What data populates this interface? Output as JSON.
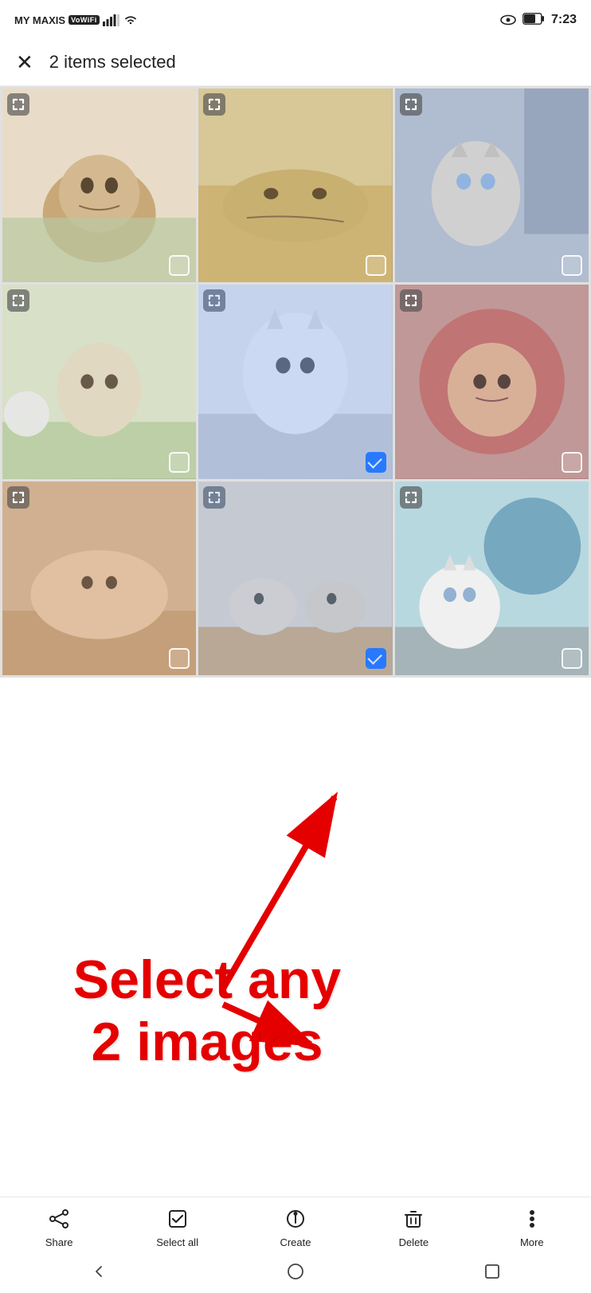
{
  "statusBar": {
    "carrier": "MY MAXIS",
    "vowifi": "VoWiFi",
    "battery": "61",
    "time": "7:23"
  },
  "header": {
    "selectedCount": "2 items selected",
    "closeLabel": "×"
  },
  "photos": [
    {
      "id": 1,
      "colorClass": "cat1",
      "selected": false
    },
    {
      "id": 2,
      "colorClass": "cat2",
      "selected": false
    },
    {
      "id": 3,
      "colorClass": "cat3",
      "selected": false
    },
    {
      "id": 4,
      "colorClass": "cat4",
      "selected": false
    },
    {
      "id": 5,
      "colorClass": "cat5",
      "selected": true
    },
    {
      "id": 6,
      "colorClass": "cat6",
      "selected": false
    },
    {
      "id": 7,
      "colorClass": "cat7",
      "selected": false
    },
    {
      "id": 8,
      "colorClass": "cat8",
      "selected": true
    },
    {
      "id": 9,
      "colorClass": "cat9",
      "selected": false
    }
  ],
  "annotation": {
    "line1": "Select any",
    "line2": "2 images"
  },
  "bottomBar": {
    "actions": [
      {
        "id": "share",
        "label": "Share",
        "icon": "share"
      },
      {
        "id": "select-all",
        "label": "Select all",
        "icon": "select-all"
      },
      {
        "id": "create",
        "label": "Create",
        "icon": "create"
      },
      {
        "id": "delete",
        "label": "Delete",
        "icon": "delete"
      },
      {
        "id": "more",
        "label": "More",
        "icon": "more"
      }
    ]
  }
}
